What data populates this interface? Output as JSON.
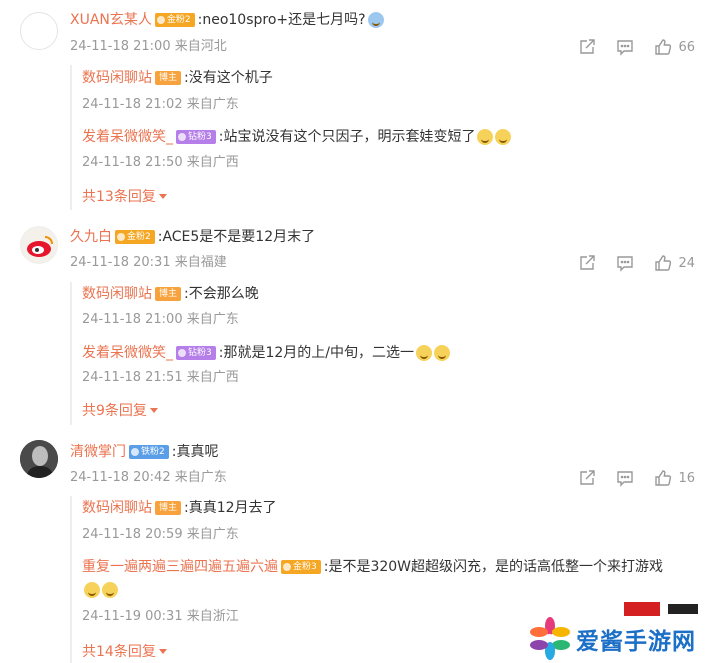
{
  "comments": [
    {
      "user": "XUAN玄某人",
      "badge": "金粉2",
      "text": ":neo10spro+还是七月吗?",
      "meta": "24-11-18 21:00 来自河北",
      "likes": "66",
      "replies": [
        {
          "user": "数码闲聊站",
          "badge": "博主",
          "text": ":没有这个机子",
          "meta": "24-11-18 21:02 来自广东"
        },
        {
          "user": "发着呆微微笑_",
          "badge": "钻粉3",
          "text": ":站宝说没有这个只因子，明示套娃变短了",
          "meta": "24-11-18 21:50 来自广西"
        }
      ],
      "more": "共13条回复"
    },
    {
      "user": "久九白",
      "badge": "金粉2",
      "text": ":ACE5是不是要12月末了",
      "meta": "24-11-18 20:31 来自福建",
      "likes": "24",
      "replies": [
        {
          "user": "数码闲聊站",
          "badge": "博主",
          "text": ":不会那么晚",
          "meta": "24-11-18 21:00 来自广东"
        },
        {
          "user": "发着呆微微笑_",
          "badge": "钻粉3",
          "text": ":那就是12月的上/中旬，二选一",
          "meta": "24-11-18 21:51 来自广西"
        }
      ],
      "more": "共9条回复"
    },
    {
      "user": "清微掌门",
      "badge": "铁粉2",
      "text": ":真真呢",
      "meta": "24-11-18 20:42 来自广东",
      "likes": "16",
      "replies": [
        {
          "user": "数码闲聊站",
          "badge": "博主",
          "text": ":真真12月去了",
          "meta": "24-11-18 20:59 来自广东"
        },
        {
          "user": "重复一遍两遍三遍四遍五遍六遍",
          "badge": "金粉3",
          "text": ":是不是320W超超级闪充，是的话高低整一个来打游戏",
          "meta": "24-11-19 00:31 来自浙江"
        }
      ],
      "more": "共14条回复"
    }
  ],
  "watermark": "爱酱手游网",
  "colors": {
    "username": "#eb7350",
    "meta": "#999999",
    "gold_badge": "#f5a623",
    "purple_badge": "#b57ee8",
    "blue_badge": "#5b9ee8"
  }
}
